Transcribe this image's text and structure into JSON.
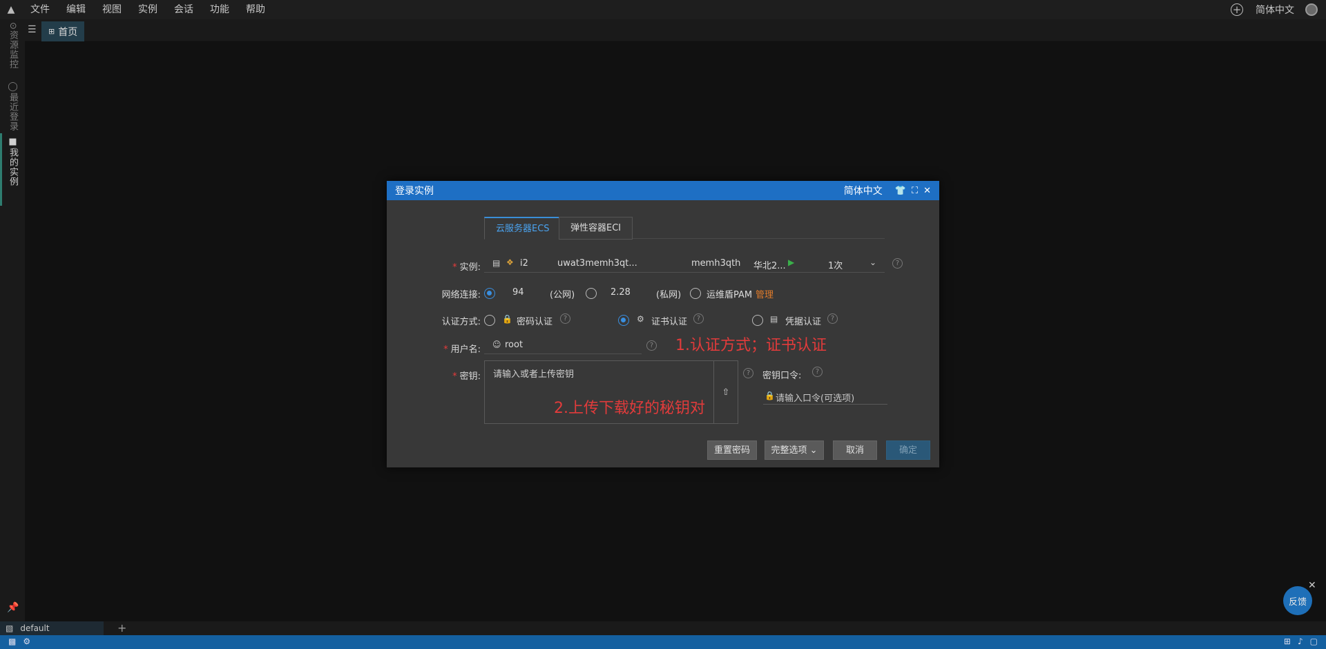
{
  "menu": {
    "items": [
      "文件",
      "编辑",
      "视图",
      "实例",
      "会话",
      "功能",
      "帮助"
    ],
    "language": "简体中文"
  },
  "sidebar": {
    "tabs": [
      {
        "label": "⊙资源监控"
      },
      {
        "label": "◯最近登录"
      },
      {
        "label": "■我的实例"
      }
    ]
  },
  "tabbar": {
    "home_label": "首页"
  },
  "terminal": {
    "tab_label": "default",
    "add_label": "+"
  },
  "feedback": {
    "label": "反馈"
  },
  "dialog": {
    "title": "登录实例",
    "language": "简体中文",
    "tabs": [
      "云服务器ECS",
      "弹性容器ECI"
    ],
    "instance": {
      "label": "实例:",
      "id_prefix": "i2",
      "id_text": "uwat3memh3qt...",
      "name_text": "memh3qth",
      "region": "华北2...",
      "count": "1次"
    },
    "network": {
      "label": "网络连接:",
      "public_ip": "94",
      "public_suffix": "(公网)",
      "private_ip": "2.28",
      "private_suffix": "(私网)",
      "bastion": "运维盾PAM",
      "manage_link": "管理"
    },
    "auth": {
      "label": "认证方式:",
      "options": [
        "密码认证",
        "证书认证",
        "凭据认证"
      ],
      "selected": "证书认证"
    },
    "username": {
      "label": "用户名:",
      "value": "root"
    },
    "key": {
      "label": "密钥:",
      "placeholder": "请输入或者上传密钥",
      "passphrase_label": "密钥口令:",
      "passphrase_placeholder": "请输入口令(可选项)"
    },
    "buttons": {
      "reset_password": "重置密码",
      "full_options": "完整选项",
      "cancel": "取消",
      "confirm": "确定"
    }
  },
  "annotations": {
    "step1": "1.认证方式；证书认证",
    "step2": "2.上传下载好的秘钥对"
  },
  "colors": {
    "accent": "#1e6fc4",
    "annotation": "#e23b3b",
    "statusbar": "#1460a0"
  }
}
